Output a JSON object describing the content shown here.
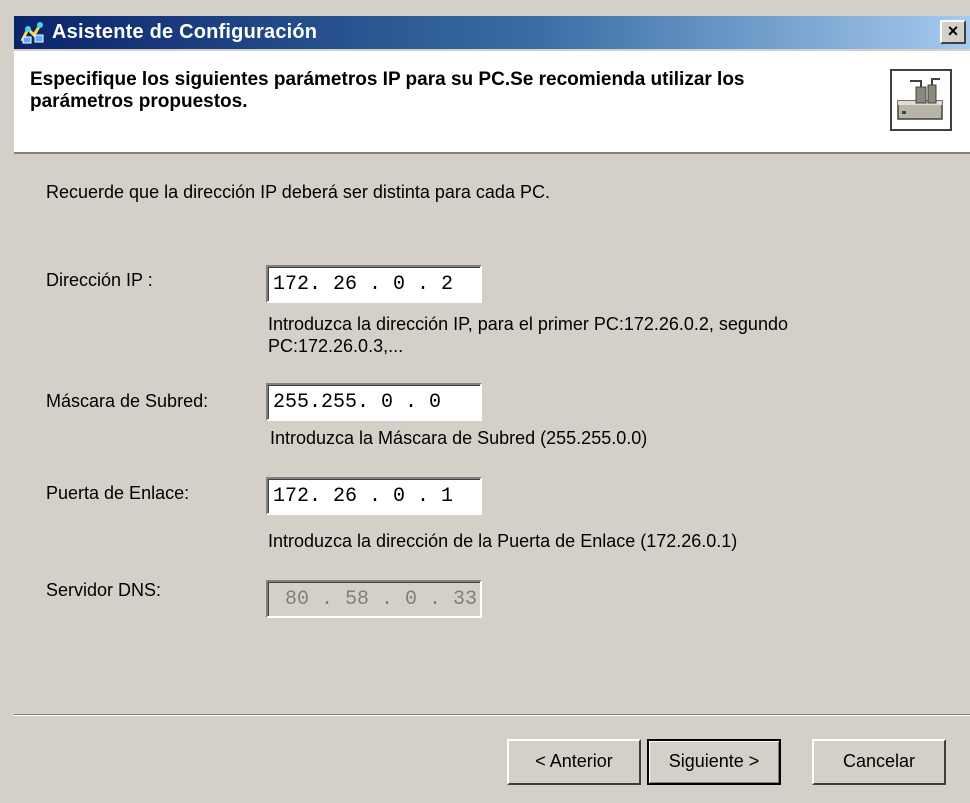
{
  "window": {
    "title": "Asistente de Configuración",
    "close_glyph": "×"
  },
  "header": {
    "text": "Especifique los siguientes parámetros IP para su PC.Se recomienda utilizar los parámetros propuestos.",
    "icon": "network-device-icon"
  },
  "body": {
    "note": "Recuerde que la dirección IP deberá ser distinta para cada PC.",
    "fields": [
      {
        "label": "Dirección IP :",
        "value": "172. 26 . 0 . 2",
        "hint": "Introduzca la dirección IP, para el primer PC:172.26.0.2, segundo PC:172.26.0.3,..."
      },
      {
        "label": "Máscara de Subred:",
        "value": "255.255. 0 . 0",
        "hint": "Introduzca la Máscara de Subred (255.255.0.0)"
      },
      {
        "label": "Puerta de Enlace:",
        "value": "172. 26 . 0 . 1",
        "hint": "Introduzca la dirección de la Puerta de Enlace (172.26.0.1)"
      },
      {
        "label": "Servidor DNS:",
        "value": " 80 . 58 . 0 . 33",
        "disabled": true
      }
    ]
  },
  "buttons": {
    "back": "< Anterior",
    "next": "Siguiente >",
    "cancel": "Cancelar"
  },
  "colors": {
    "face": "#d4d0c8",
    "titlebar_start": "#0a246a",
    "titlebar_end": "#a6caf0"
  }
}
